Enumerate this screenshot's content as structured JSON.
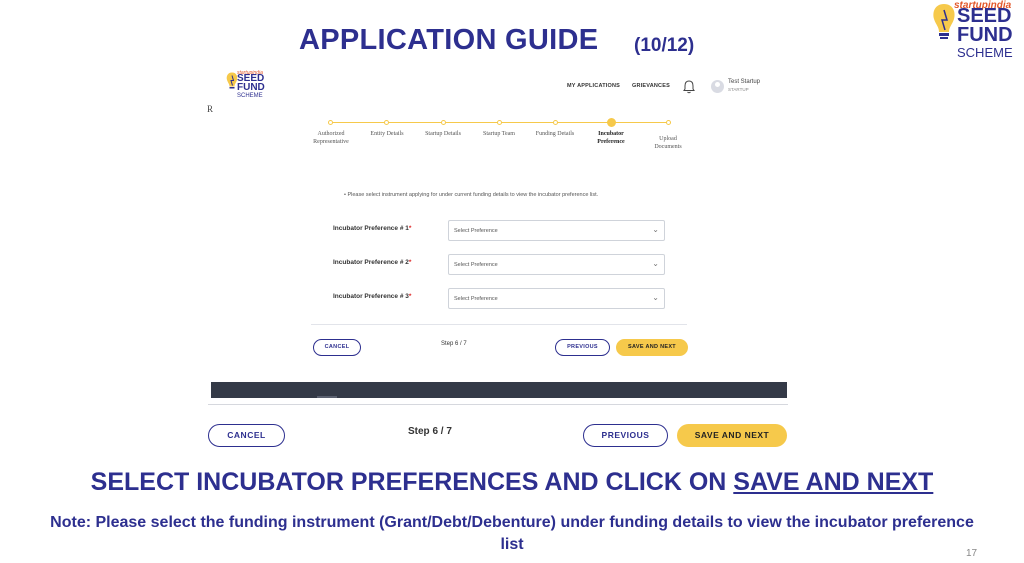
{
  "slide": {
    "title": "APPLICATION GUIDE",
    "counter": "(10/12)",
    "instruction_prefix": "SELECT INCUBATOR PREFERENCES AND CLICK ON ",
    "instruction_link": "SAVE AND NEXT",
    "note": "Note: Please select the funding instrument (Grant/Debt/Debenture) under funding details to view the incubator preference list",
    "page_number": "17"
  },
  "logo": {
    "brand": "startupindia",
    "line1": "SEED",
    "line2": "FUND",
    "line3": "SCHEME"
  },
  "app_header": {
    "nav": [
      "MY APPLICATIONS",
      "GRIEVANCES"
    ],
    "user_name": "Test Startup",
    "user_role": "STARTUP",
    "stray_text": "R"
  },
  "stepper": {
    "steps": [
      {
        "label1": "Authorized",
        "label2": "Representative"
      },
      {
        "label1": "Entity Details",
        "label2": ""
      },
      {
        "label1": "Startup Details",
        "label2": ""
      },
      {
        "label1": "Startup Team",
        "label2": ""
      },
      {
        "label1": "Funding Details",
        "label2": ""
      },
      {
        "label1": "Incubator",
        "label2": "Preference"
      },
      {
        "label1": "Upload",
        "label2": "Documents"
      }
    ],
    "active_index": 5
  },
  "form": {
    "info": "Please select instrument applying for under current funding details to view the incubator preference list.",
    "preferences": [
      {
        "label": "Incubator Preference # 1",
        "required": "*",
        "placeholder": "Select Preference"
      },
      {
        "label": "Incubator Preference # 2",
        "required": "*",
        "placeholder": "Select Preference"
      },
      {
        "label": "Incubator Preference # 3",
        "required": "*",
        "placeholder": "Select Preference"
      }
    ]
  },
  "actions": {
    "cancel": "CANCEL",
    "step": "Step 6 / 7",
    "previous": "PREVIOUS",
    "save_next": "SAVE AND NEXT"
  },
  "colors": {
    "navy": "#2d2f8f",
    "accent_yellow": "#f6c94b",
    "footer_dark": "#343a47",
    "brand_orange": "#e2572a"
  }
}
